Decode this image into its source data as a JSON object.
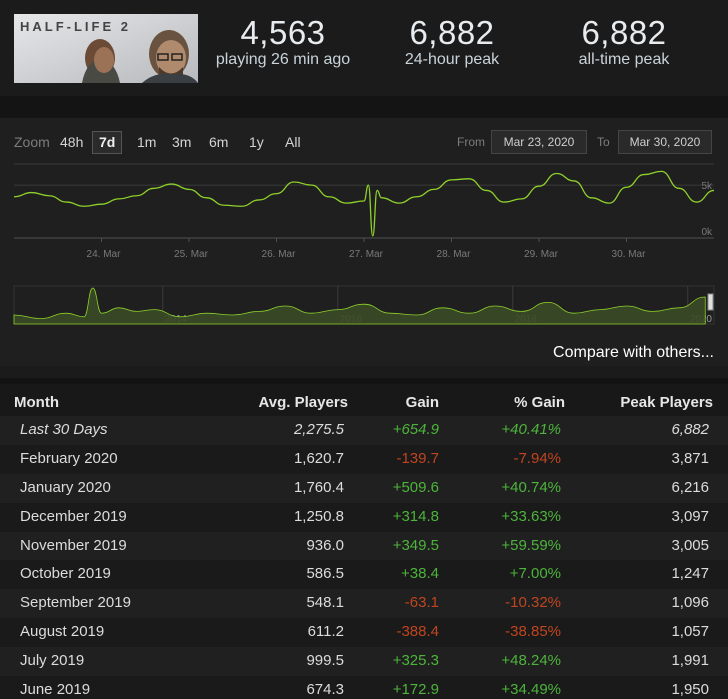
{
  "header": {
    "logo_text": "HALF-LIFE 2",
    "stats": [
      {
        "value": "4,563",
        "label": "playing 26 min ago"
      },
      {
        "value": "6,882",
        "label": "24-hour peak"
      },
      {
        "value": "6,882",
        "label": "all-time peak"
      }
    ]
  },
  "zoom": {
    "label": "Zoom",
    "options": [
      "48h",
      "7d",
      "1m",
      "3m",
      "6m",
      "1y",
      "All"
    ],
    "active": "7d"
  },
  "range": {
    "from_label": "From",
    "from_value": "Mar 23, 2020",
    "to_label": "To",
    "to_value": "Mar 30, 2020"
  },
  "chart_data": [
    {
      "type": "line",
      "title": "",
      "x_ticks": [
        "24. Mar",
        "25. Mar",
        "26. Mar",
        "27. Mar",
        "28. Mar",
        "29. Mar",
        "30. Mar"
      ],
      "y_ticks": [
        "5k",
        "0k"
      ],
      "ylim": [
        0,
        7000
      ],
      "grid": true,
      "series": [
        {
          "color": "#8fd12b",
          "x": [
            23.0,
            23.2,
            23.4,
            23.6,
            23.8,
            24.0,
            24.2,
            24.4,
            24.6,
            24.8,
            25.0,
            25.2,
            25.4,
            25.6,
            25.8,
            26.0,
            26.2,
            26.4,
            26.6,
            26.8,
            27.0,
            27.05,
            27.1,
            27.15,
            27.2,
            27.4,
            27.6,
            27.8,
            28.0,
            28.2,
            28.4,
            28.6,
            28.8,
            29.0,
            29.2,
            29.4,
            29.6,
            29.8,
            30.0,
            30.2,
            30.4,
            30.6,
            30.8,
            31.0
          ],
          "y": [
            3900,
            4300,
            4000,
            3400,
            3000,
            3200,
            3700,
            4000,
            4700,
            5100,
            4600,
            3800,
            3100,
            3000,
            3600,
            4200,
            5300,
            5000,
            3900,
            3300,
            3500,
            5000,
            200,
            4500,
            3800,
            3300,
            3900,
            4600,
            5500,
            5600,
            4500,
            3400,
            3700,
            4900,
            6100,
            5400,
            3800,
            3300,
            4800,
            6000,
            6300,
            4700,
            3400,
            4500
          ]
        }
      ]
    },
    {
      "type": "area",
      "title": "",
      "x_ticks": [
        "2014",
        "2016",
        "2018",
        "2020"
      ],
      "series": [
        {
          "color": "#8fd12b",
          "x": [
            2012.3,
            2012.6,
            2012.9,
            2013.1,
            2013.2,
            2013.3,
            2013.5,
            2013.7,
            2013.9,
            2014.2,
            2014.5,
            2014.8,
            2015.1,
            2015.4,
            2015.7,
            2016.0,
            2016.3,
            2016.6,
            2016.9,
            2017.2,
            2017.5,
            2017.8,
            2018.1,
            2018.4,
            2018.7,
            2019.0,
            2019.3,
            2019.6,
            2019.9,
            2020.2
          ],
          "y": [
            0.25,
            0.15,
            0.3,
            0.2,
            1.0,
            0.3,
            0.45,
            0.35,
            0.4,
            0.2,
            0.3,
            0.25,
            0.35,
            0.5,
            0.3,
            0.4,
            0.55,
            0.3,
            0.25,
            0.45,
            0.3,
            0.5,
            0.35,
            0.6,
            0.3,
            0.4,
            0.5,
            0.35,
            0.45,
            0.75
          ]
        }
      ]
    }
  ],
  "compare_link": "Compare with others...",
  "table": {
    "headers": {
      "month": "Month",
      "avg": "Avg. Players",
      "gain": "Gain",
      "pct": "% Gain",
      "peak": "Peak Players"
    },
    "rows": [
      {
        "month": "Last 30 Days",
        "avg": "2,275.5",
        "gain": "+654.9",
        "pct": "+40.41%",
        "peak": "6,882"
      },
      {
        "month": "February 2020",
        "avg": "1,620.7",
        "gain": "-139.7",
        "pct": "-7.94%",
        "peak": "3,871"
      },
      {
        "month": "January 2020",
        "avg": "1,760.4",
        "gain": "+509.6",
        "pct": "+40.74%",
        "peak": "6,216"
      },
      {
        "month": "December 2019",
        "avg": "1,250.8",
        "gain": "+314.8",
        "pct": "+33.63%",
        "peak": "3,097"
      },
      {
        "month": "November 2019",
        "avg": "936.0",
        "gain": "+349.5",
        "pct": "+59.59%",
        "peak": "3,005"
      },
      {
        "month": "October 2019",
        "avg": "586.5",
        "gain": "+38.4",
        "pct": "+7.00%",
        "peak": "1,247"
      },
      {
        "month": "September 2019",
        "avg": "548.1",
        "gain": "-63.1",
        "pct": "-10.32%",
        "peak": "1,096"
      },
      {
        "month": "August 2019",
        "avg": "611.2",
        "gain": "-388.4",
        "pct": "-38.85%",
        "peak": "1,057"
      },
      {
        "month": "July 2019",
        "avg": "999.5",
        "gain": "+325.3",
        "pct": "+48.24%",
        "peak": "1,991"
      },
      {
        "month": "June 2019",
        "avg": "674.3",
        "gain": "+172.9",
        "pct": "+34.49%",
        "peak": "1,950"
      }
    ]
  },
  "colors": {
    "positive": "#4db43b",
    "negative": "#c0451f",
    "line": "#8fd12b"
  }
}
